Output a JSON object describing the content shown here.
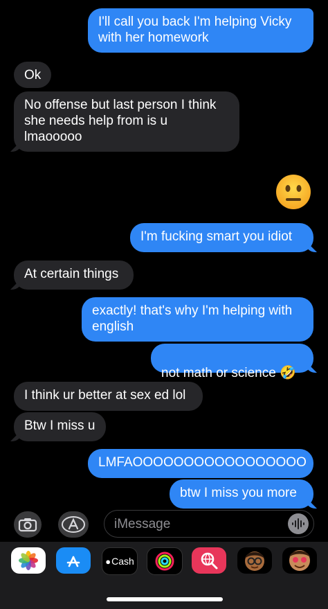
{
  "messages": [
    {
      "from": "me",
      "text": "I'll call you back I'm helping Vicky\nwith her homework"
    },
    {
      "from": "them",
      "text": "Ok"
    },
    {
      "from": "them",
      "text": "No offense but last person I think\nshe needs help from is u\nlmaooooo"
    },
    {
      "from": "me",
      "text": "😐",
      "kind": "emoji"
    },
    {
      "from": "me",
      "text": "I'm fucking smart you idiot"
    },
    {
      "from": "them",
      "text": "At certain things"
    },
    {
      "from": "me",
      "text": "exactly! that's why I'm helping with\nenglish"
    },
    {
      "from": "me",
      "text": "not math or science 🤣"
    },
    {
      "from": "them",
      "text": "I think ur better at sex ed lol"
    },
    {
      "from": "them",
      "text": "Btw I miss u"
    },
    {
      "from": "me",
      "text": "LMFAOOOOOOOOOOOOOOOOO"
    },
    {
      "from": "me",
      "text": "btw I miss you more"
    }
  ],
  "input": {
    "placeholder": "iMessage"
  },
  "apps": [
    {
      "name": "photos-icon"
    },
    {
      "name": "app-store-icon"
    },
    {
      "name": "apple-cash-icon",
      "label": "Cash"
    },
    {
      "name": "activity-icon"
    },
    {
      "name": "image-search-icon"
    },
    {
      "name": "memoji-icon"
    },
    {
      "name": "memoji-stickers-icon"
    }
  ],
  "colors": {
    "sent": "#2f86f5",
    "received": "#262629",
    "background": "#000000"
  }
}
